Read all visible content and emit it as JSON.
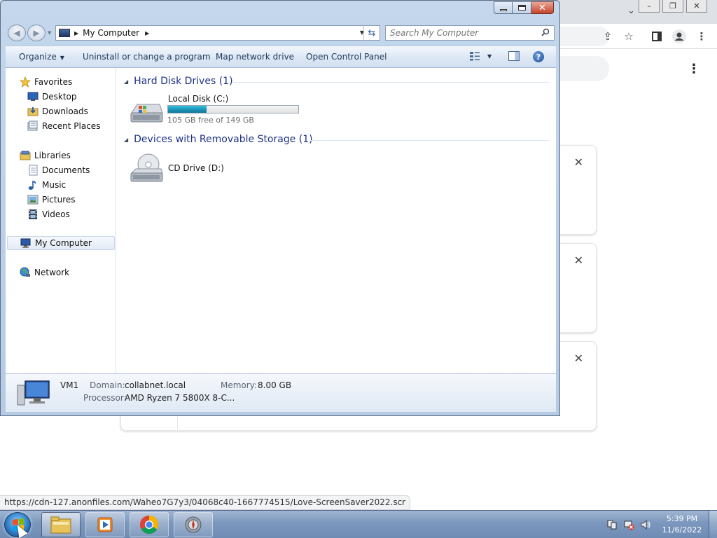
{
  "browser": {
    "status_url": "https://cdn-127.anonfiles.com/Waheo7G7y3/04068c40-1667774515/Love-ScreenSaver2022.scr",
    "close_glyph": "✕"
  },
  "explorer": {
    "address": {
      "location": "My Computer"
    },
    "search": {
      "placeholder": "Search My Computer"
    },
    "commands": {
      "organize": "Organize",
      "uninstall": "Uninstall or change a program",
      "map_drive": "Map network drive",
      "control_panel": "Open Control Panel"
    },
    "nav": {
      "favorites": "Favorites",
      "desktop": "Desktop",
      "downloads": "Downloads",
      "recent_places": "Recent Places",
      "libraries": "Libraries",
      "documents": "Documents",
      "music": "Music",
      "pictures": "Pictures",
      "videos": "Videos",
      "my_computer": "My Computer",
      "network": "Network"
    },
    "groups": {
      "hard_disk": "Hard Disk Drives (1)",
      "removable": "Devices with Removable Storage (1)"
    },
    "drives": {
      "c": {
        "name": "Local Disk (C:)",
        "free_text": "105 GB free of 149 GB",
        "used_fraction": 0.295
      },
      "d": {
        "name": "CD Drive (D:)"
      }
    },
    "details": {
      "computer_name": "VM1",
      "domain_label": "Domain:",
      "domain_value": "collabnet.local",
      "memory_label": "Memory:",
      "memory_value": "8.00 GB",
      "processor_label": "Processor:",
      "processor_value": "AMD Ryzen 7 5800X 8-C..."
    }
  },
  "taskbar": {
    "clock_time": "5:39 PM",
    "clock_date": "11/6/2022"
  }
}
